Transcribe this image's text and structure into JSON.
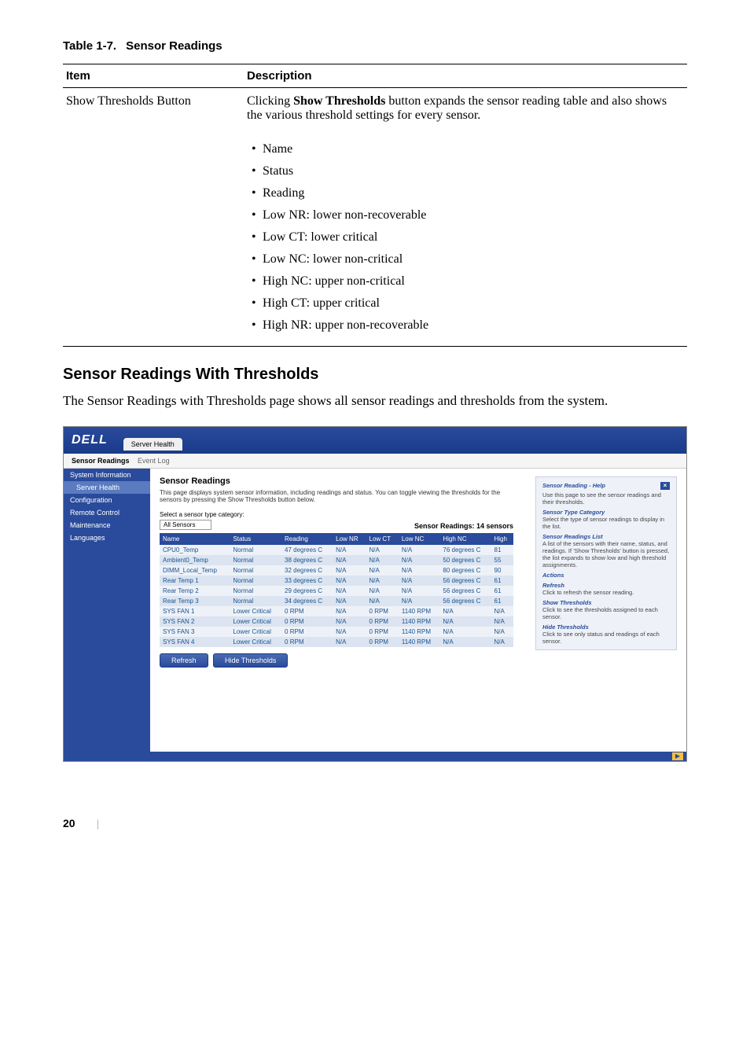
{
  "table": {
    "label": "Table 1-7.",
    "title": "Sensor Readings",
    "headers": {
      "col1": "Item",
      "col2": "Description"
    },
    "row": {
      "item": "Show Thresholds Button",
      "desc_prefix": "Clicking ",
      "desc_bold": "Show Thresholds",
      "desc_suffix": " button expands the sensor reading table and also shows the various threshold settings for every sensor.",
      "bullets": [
        "Name",
        "Status",
        "Reading",
        "Low NR: lower non-recoverable",
        "Low CT: lower critical",
        "Low NC: lower non-critical",
        "High NC: upper non-critical",
        "High CT: upper critical",
        "High NR: upper non-recoverable"
      ]
    }
  },
  "section": {
    "heading": "Sensor Readings With Thresholds",
    "body": "The Sensor Readings with Thresholds page shows all sensor readings and thresholds from the system."
  },
  "screenshot": {
    "logo": "DELL",
    "main_tab": "Server Health",
    "subtabs": {
      "active": "Sensor Readings",
      "other": "Event Log"
    },
    "sidebar": [
      {
        "label": "System Information",
        "active": false
      },
      {
        "label": "Server Health",
        "active": true,
        "sub": true
      },
      {
        "label": "Configuration",
        "active": false
      },
      {
        "label": "Remote Control",
        "active": false
      },
      {
        "label": "Maintenance",
        "active": false
      },
      {
        "label": "Languages",
        "active": false
      }
    ],
    "panel": {
      "title": "Sensor Readings",
      "desc": "This page displays system sensor information, including readings and status. You can toggle viewing the thresholds for the sensors by pressing the Show Thresholds button below.",
      "select_label": "Select a sensor type category:",
      "select_value": "All Sensors",
      "count": "Sensor Readings: 14 sensors"
    },
    "grid": {
      "headers": [
        "Name",
        "Status",
        "Reading",
        "Low NR",
        "Low CT",
        "Low NC",
        "High NC",
        "High"
      ],
      "rows": [
        [
          "CPU0_Temp",
          "Normal",
          "47 degrees C",
          "N/A",
          "N/A",
          "N/A",
          "76 degrees C",
          "81"
        ],
        [
          "Ambient0_Temp",
          "Normal",
          "38 degrees C",
          "N/A",
          "N/A",
          "N/A",
          "50 degrees C",
          "55"
        ],
        [
          "DIMM_Local_Temp",
          "Normal",
          "32 degrees C",
          "N/A",
          "N/A",
          "N/A",
          "80 degrees C",
          "90"
        ],
        [
          "Rear Temp 1",
          "Normal",
          "33 degrees C",
          "N/A",
          "N/A",
          "N/A",
          "56 degrees C",
          "61"
        ],
        [
          "Rear Temp 2",
          "Normal",
          "29 degrees C",
          "N/A",
          "N/A",
          "N/A",
          "56 degrees C",
          "61"
        ],
        [
          "Rear Temp 3",
          "Normal",
          "34 degrees C",
          "N/A",
          "N/A",
          "N/A",
          "56 degrees C",
          "61"
        ],
        [
          "SYS FAN 1",
          "Lower Critical",
          "0 RPM",
          "N/A",
          "0 RPM",
          "1140 RPM",
          "N/A",
          "N/A"
        ],
        [
          "SYS FAN 2",
          "Lower Critical",
          "0 RPM",
          "N/A",
          "0 RPM",
          "1140 RPM",
          "N/A",
          "N/A"
        ],
        [
          "SYS FAN 3",
          "Lower Critical",
          "0 RPM",
          "N/A",
          "0 RPM",
          "1140 RPM",
          "N/A",
          "N/A"
        ],
        [
          "SYS FAN 4",
          "Lower Critical",
          "0 RPM",
          "N/A",
          "0 RPM",
          "1140 RPM",
          "N/A",
          "N/A"
        ]
      ]
    },
    "buttons": {
      "refresh": "Refresh",
      "hide": "Hide Thresholds"
    },
    "help": {
      "title": "Sensor Reading - Help",
      "intro": "Use this page to see the sensor readings and their thresholds.",
      "sections": [
        {
          "h": "Sensor Type Category",
          "t": "Select the type of sensor readings to display in the list."
        },
        {
          "h": "Sensor Readings List",
          "t": "A list of the sensors with their name, status, and readings. If 'Show Thresholds' button is pressed, the list expands to show low and high threshold assignments."
        },
        {
          "h": "Actions",
          "t": ""
        },
        {
          "h": "Refresh",
          "t": "Click to refresh the sensor reading."
        },
        {
          "h": "Show Thresholds",
          "t": "Click to see the thresholds assigned to each sensor."
        },
        {
          "h": "Hide Thresholds",
          "t": "Click to see only status and readings of each sensor."
        }
      ]
    }
  },
  "footer": {
    "page": "20"
  }
}
